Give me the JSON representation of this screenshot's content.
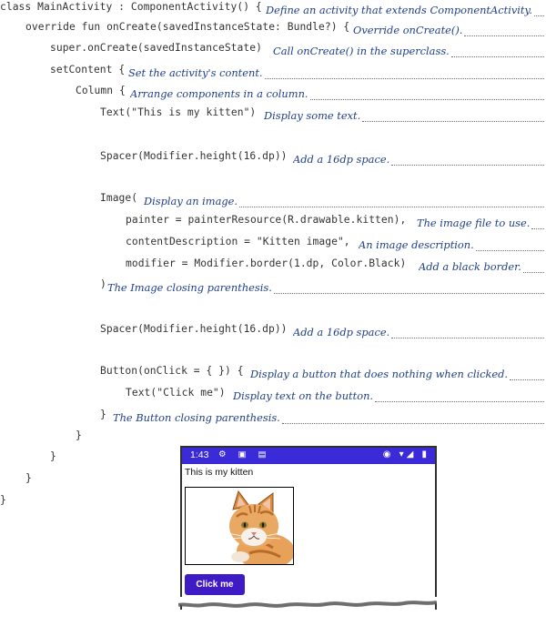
{
  "lines": [
    {
      "code": "class MainActivity : ComponentActivity() {",
      "note": "Define an activity that extends ComponentActivity."
    },
    {
      "code": "override fun onCreate(savedInstanceState: Bundle?) {",
      "note": "Override onCreate()."
    },
    {
      "code": "super.onCreate(savedInstanceState)",
      "note": "Call onCreate() in the superclass."
    },
    {
      "code": "setContent {",
      "note": "Set the activity's content."
    },
    {
      "code": "Column {",
      "note": "Arrange components in a column."
    },
    {
      "code": "Text(\"This is my kitten\")",
      "note": "Display some text."
    },
    {
      "code": "Spacer(Modifier.height(16.dp))",
      "note": "Add a 16dp space."
    },
    {
      "code": "Image(",
      "note": "Display an image."
    },
    {
      "code": "painter = painterResource(R.drawable.kitten),",
      "note": "The image file to use."
    },
    {
      "code": "contentDescription = \"Kitten image\",",
      "note": "An image description."
    },
    {
      "code": "modifier = Modifier.border(1.dp, Color.Black)",
      "note": "Add a black border."
    },
    {
      "code": ")",
      "note": "The Image closing parenthesis."
    },
    {
      "code": "Spacer(Modifier.height(16.dp))",
      "note": "Add a 16dp space."
    },
    {
      "code": "Button(onClick = { }) {",
      "note": "Display a button that does nothing when clicked."
    },
    {
      "code": "Text(\"Click me\")",
      "note": "Display text on the button."
    },
    {
      "code": "}",
      "note": "The Button closing parenthesis."
    },
    {
      "code": "}",
      "note": ""
    },
    {
      "code": "}",
      "note": ""
    },
    {
      "code": "}",
      "note": ""
    },
    {
      "code": "}",
      "note": ""
    }
  ],
  "phone": {
    "status_time": "1:43",
    "status_left_icons": "⚙ ▣ ▤",
    "status_right_icons": "◉ ▾◢ ▮",
    "app_text": "This is my kitten",
    "button_label": "Click me",
    "image_description": "Kitten image",
    "status_bar_color": "#3b2ad8",
    "button_color": "#3f1bc6"
  },
  "colors": {
    "note_ink": "#1e3f8a",
    "code_ink": "#333333"
  }
}
